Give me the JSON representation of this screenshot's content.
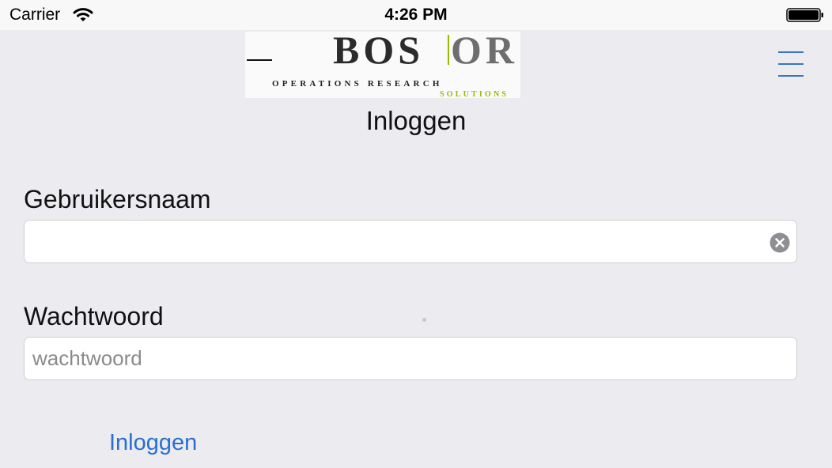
{
  "status_bar": {
    "carrier": "Carrier",
    "time": "4:26 PM",
    "wifi_icon": "wifi-icon",
    "battery_icon": "battery-icon"
  },
  "logo": {
    "text_left": "BOS",
    "text_right": "OR",
    "subtitle": "OPERATIONS RESEARCH",
    "tagline": "SOLUTIONS",
    "accent_color": "#9cb800"
  },
  "header": {
    "menu_icon": "hamburger-menu-icon",
    "title": "Inloggen"
  },
  "form": {
    "username": {
      "label": "Gebruikersnaam",
      "value": "",
      "placeholder": "",
      "clear_icon": "clear-icon"
    },
    "password": {
      "label": "Wachtwoord",
      "value": "",
      "placeholder": "wachtwoord"
    },
    "submit_label": "Inloggen"
  },
  "colors": {
    "background": "#ebebf0",
    "link": "#2a6fd0",
    "menu": "#3a75c4"
  }
}
